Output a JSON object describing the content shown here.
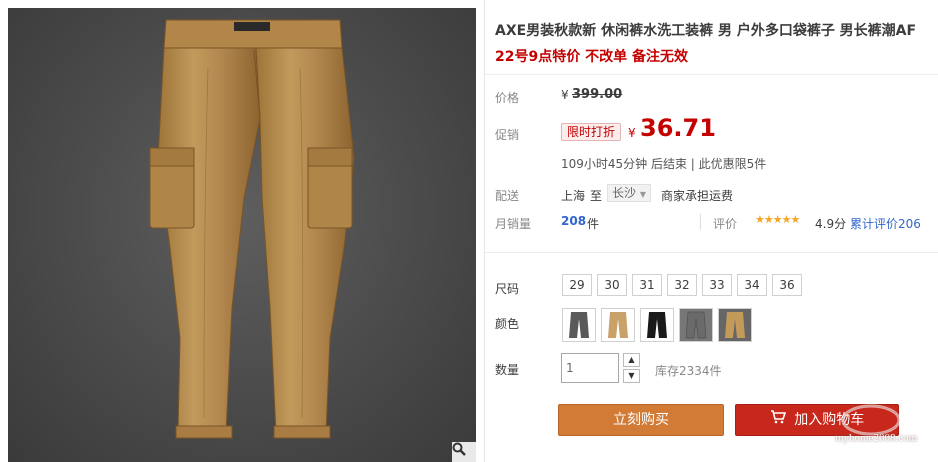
{
  "product": {
    "title": "AXE男装秋款新 休闲裤水洗工装裤 男 户外多口袋裤子 男长裤潮AF",
    "subtitle": "22号9点特价 不改单 备注无效"
  },
  "price": {
    "label": "价格",
    "currency": "¥",
    "original": "399.00"
  },
  "promotion": {
    "label": "促销",
    "tag": "限时打折",
    "currency": "¥",
    "price": "36.71",
    "countdown": "109小时45分钟 后结束 | 此优惠限5件"
  },
  "shipping": {
    "label": "配送",
    "from": "上海",
    "to_word": "至",
    "destination": "长沙",
    "note": "商家承担运费"
  },
  "sales": {
    "label": "月销量",
    "count": "208",
    "unit": "件",
    "rating_label": "评价",
    "stars": "★★★★★",
    "score": "4.9分",
    "total_reviews": "累计评价206"
  },
  "size": {
    "label": "尺码",
    "options": [
      "29",
      "30",
      "31",
      "32",
      "33",
      "34",
      "36"
    ]
  },
  "color": {
    "label": "颜色",
    "swatches": [
      "#5a5a5a",
      "#c9a26a",
      "#1a1a1a",
      "#6a6a6a",
      "#c49a5a"
    ]
  },
  "quantity": {
    "label": "数量",
    "value": "1",
    "stock": "库存2334件"
  },
  "actions": {
    "buy_now": "立刻购买",
    "add_to_cart": "加入购物车"
  },
  "watermark": {
    "text": "myhome2008.com"
  },
  "colors": {
    "accent_red": "#c40000",
    "buy_orange": "#d17b37",
    "cart_red": "#c8281b",
    "pants_khaki": "#b68a4e"
  }
}
